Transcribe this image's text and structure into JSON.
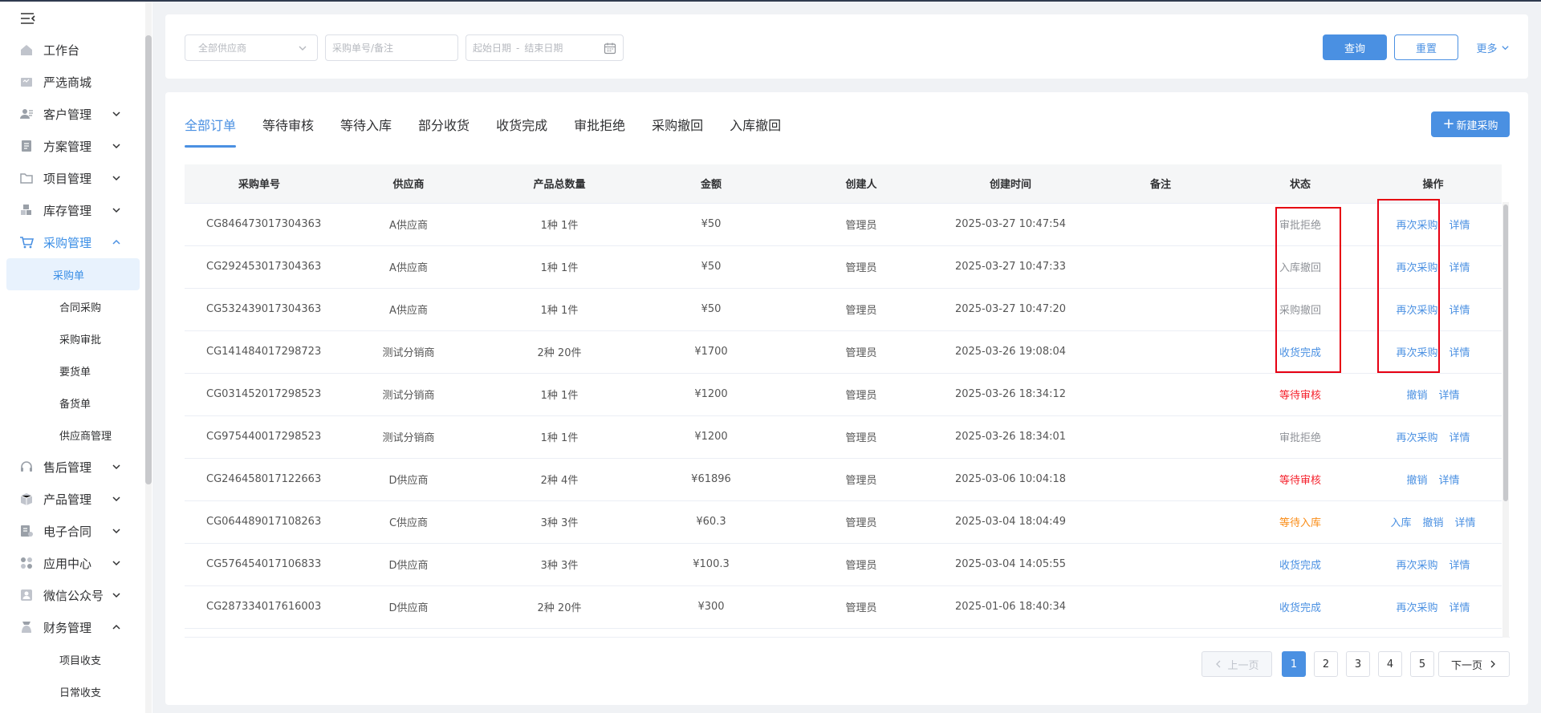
{
  "sidebar": {
    "items": [
      {
        "label": "工作台",
        "icon": "home-icon"
      },
      {
        "label": "严选商城",
        "icon": "mall-icon"
      },
      {
        "label": "客户管理",
        "icon": "customer-icon",
        "expandable": true
      },
      {
        "label": "方案管理",
        "icon": "plan-icon",
        "expandable": true
      },
      {
        "label": "项目管理",
        "icon": "folder-icon",
        "expandable": true
      },
      {
        "label": "库存管理",
        "icon": "inventory-icon",
        "expandable": true
      },
      {
        "label": "采购管理",
        "icon": "cart-icon",
        "expandable": true,
        "expanded": true,
        "active": true
      },
      {
        "label": "售后管理",
        "icon": "headset-icon",
        "expandable": true
      },
      {
        "label": "产品管理",
        "icon": "box-icon",
        "expandable": true
      },
      {
        "label": "电子合同",
        "icon": "contract-icon",
        "expandable": true
      },
      {
        "label": "应用中心",
        "icon": "apps-icon",
        "expandable": true
      },
      {
        "label": "微信公众号",
        "icon": "wechat-icon",
        "expandable": true
      },
      {
        "label": "财务管理",
        "icon": "finance-icon",
        "expandable": true,
        "expanded": true
      }
    ],
    "purchase_sub": [
      "采购单",
      "合同采购",
      "采购审批",
      "要货单",
      "备货单",
      "供应商管理"
    ],
    "finance_sub": [
      "项目收支",
      "日常收支"
    ]
  },
  "filter": {
    "supplier_placeholder": "全部供应商",
    "search_placeholder": "采购单号/备注",
    "start_date_placeholder": "起始日期",
    "date_separator": "-",
    "end_date_placeholder": "结束日期",
    "query_label": "查询",
    "reset_label": "重置",
    "more_label": "更多"
  },
  "tabs": [
    "全部订单",
    "等待审核",
    "等待入库",
    "部分收货",
    "收货完成",
    "审批拒绝",
    "采购撤回",
    "入库撤回"
  ],
  "new_button_label": "新建采购",
  "table": {
    "headers": [
      "采购单号",
      "供应商",
      "产品总数量",
      "金额",
      "创建人",
      "创建时间",
      "备注",
      "状态",
      "操作"
    ],
    "rows": [
      {
        "no": "CG846473017304363",
        "supplier": "A供应商",
        "qty": "1种 1件",
        "amount": "¥50",
        "creator": "管理员",
        "time": "2025-03-27 10:47:54",
        "note": "",
        "status": "审批拒绝",
        "status_color": "gray",
        "ops": [
          "再次采购",
          "详情"
        ]
      },
      {
        "no": "CG292453017304363",
        "supplier": "A供应商",
        "qty": "1种 1件",
        "amount": "¥50",
        "creator": "管理员",
        "time": "2025-03-27 10:47:33",
        "note": "",
        "status": "入库撤回",
        "status_color": "gray",
        "ops": [
          "再次采购",
          "详情"
        ]
      },
      {
        "no": "CG532439017304363",
        "supplier": "A供应商",
        "qty": "1种 1件",
        "amount": "¥50",
        "creator": "管理员",
        "time": "2025-03-27 10:47:20",
        "note": "",
        "status": "采购撤回",
        "status_color": "gray",
        "ops": [
          "再次采购",
          "详情"
        ]
      },
      {
        "no": "CG141484017298723",
        "supplier": "测试分销商",
        "qty": "2种 20件",
        "amount": "¥1700",
        "creator": "管理员",
        "time": "2025-03-26 19:08:04",
        "note": "",
        "status": "收货完成",
        "status_color": "blue",
        "ops": [
          "再次采购",
          "详情"
        ]
      },
      {
        "no": "CG031452017298523",
        "supplier": "测试分销商",
        "qty": "1种 1件",
        "amount": "¥1200",
        "creator": "管理员",
        "time": "2025-03-26 18:34:12",
        "note": "",
        "status": "等待审核",
        "status_color": "red",
        "ops": [
          "撤销",
          "详情"
        ]
      },
      {
        "no": "CG975440017298523",
        "supplier": "测试分销商",
        "qty": "1种 1件",
        "amount": "¥1200",
        "creator": "管理员",
        "time": "2025-03-26 18:34:01",
        "note": "",
        "status": "审批拒绝",
        "status_color": "gray",
        "ops": [
          "再次采购",
          "详情"
        ]
      },
      {
        "no": "CG246458017122663",
        "supplier": "D供应商",
        "qty": "2种 4件",
        "amount": "¥61896",
        "creator": "管理员",
        "time": "2025-03-06 10:04:18",
        "note": "",
        "status": "等待审核",
        "status_color": "red",
        "ops": [
          "撤销",
          "详情"
        ]
      },
      {
        "no": "CG064489017108263",
        "supplier": "C供应商",
        "qty": "3种 3件",
        "amount": "¥60.3",
        "creator": "管理员",
        "time": "2025-03-04 18:04:49",
        "note": "",
        "status": "等待入库",
        "status_color": "orange",
        "ops": [
          "入库",
          "撤销",
          "详情"
        ]
      },
      {
        "no": "CG576454017106833",
        "supplier": "D供应商",
        "qty": "3种 3件",
        "amount": "¥100.3",
        "creator": "管理员",
        "time": "2025-03-04 14:05:55",
        "note": "",
        "status": "收货完成",
        "status_color": "blue",
        "ops": [
          "再次采购",
          "详情"
        ]
      },
      {
        "no": "CG287334017616003",
        "supplier": "D供应商",
        "qty": "2种 20件",
        "amount": "¥300",
        "creator": "管理员",
        "time": "2025-01-06 18:40:34",
        "note": "",
        "status": "收货完成",
        "status_color": "blue",
        "ops": [
          "再次采购",
          "详情"
        ]
      }
    ]
  },
  "pagination": {
    "prev_label": "上一页",
    "next_label": "下一页",
    "pages": [
      "1",
      "2",
      "3",
      "4",
      "5"
    ],
    "current": "1"
  },
  "colors": {
    "primary": "#4a90e2",
    "highlight_box": "#e60012",
    "status_red": "#f5222d",
    "status_orange": "#fa8c16",
    "status_gray": "#909399"
  }
}
